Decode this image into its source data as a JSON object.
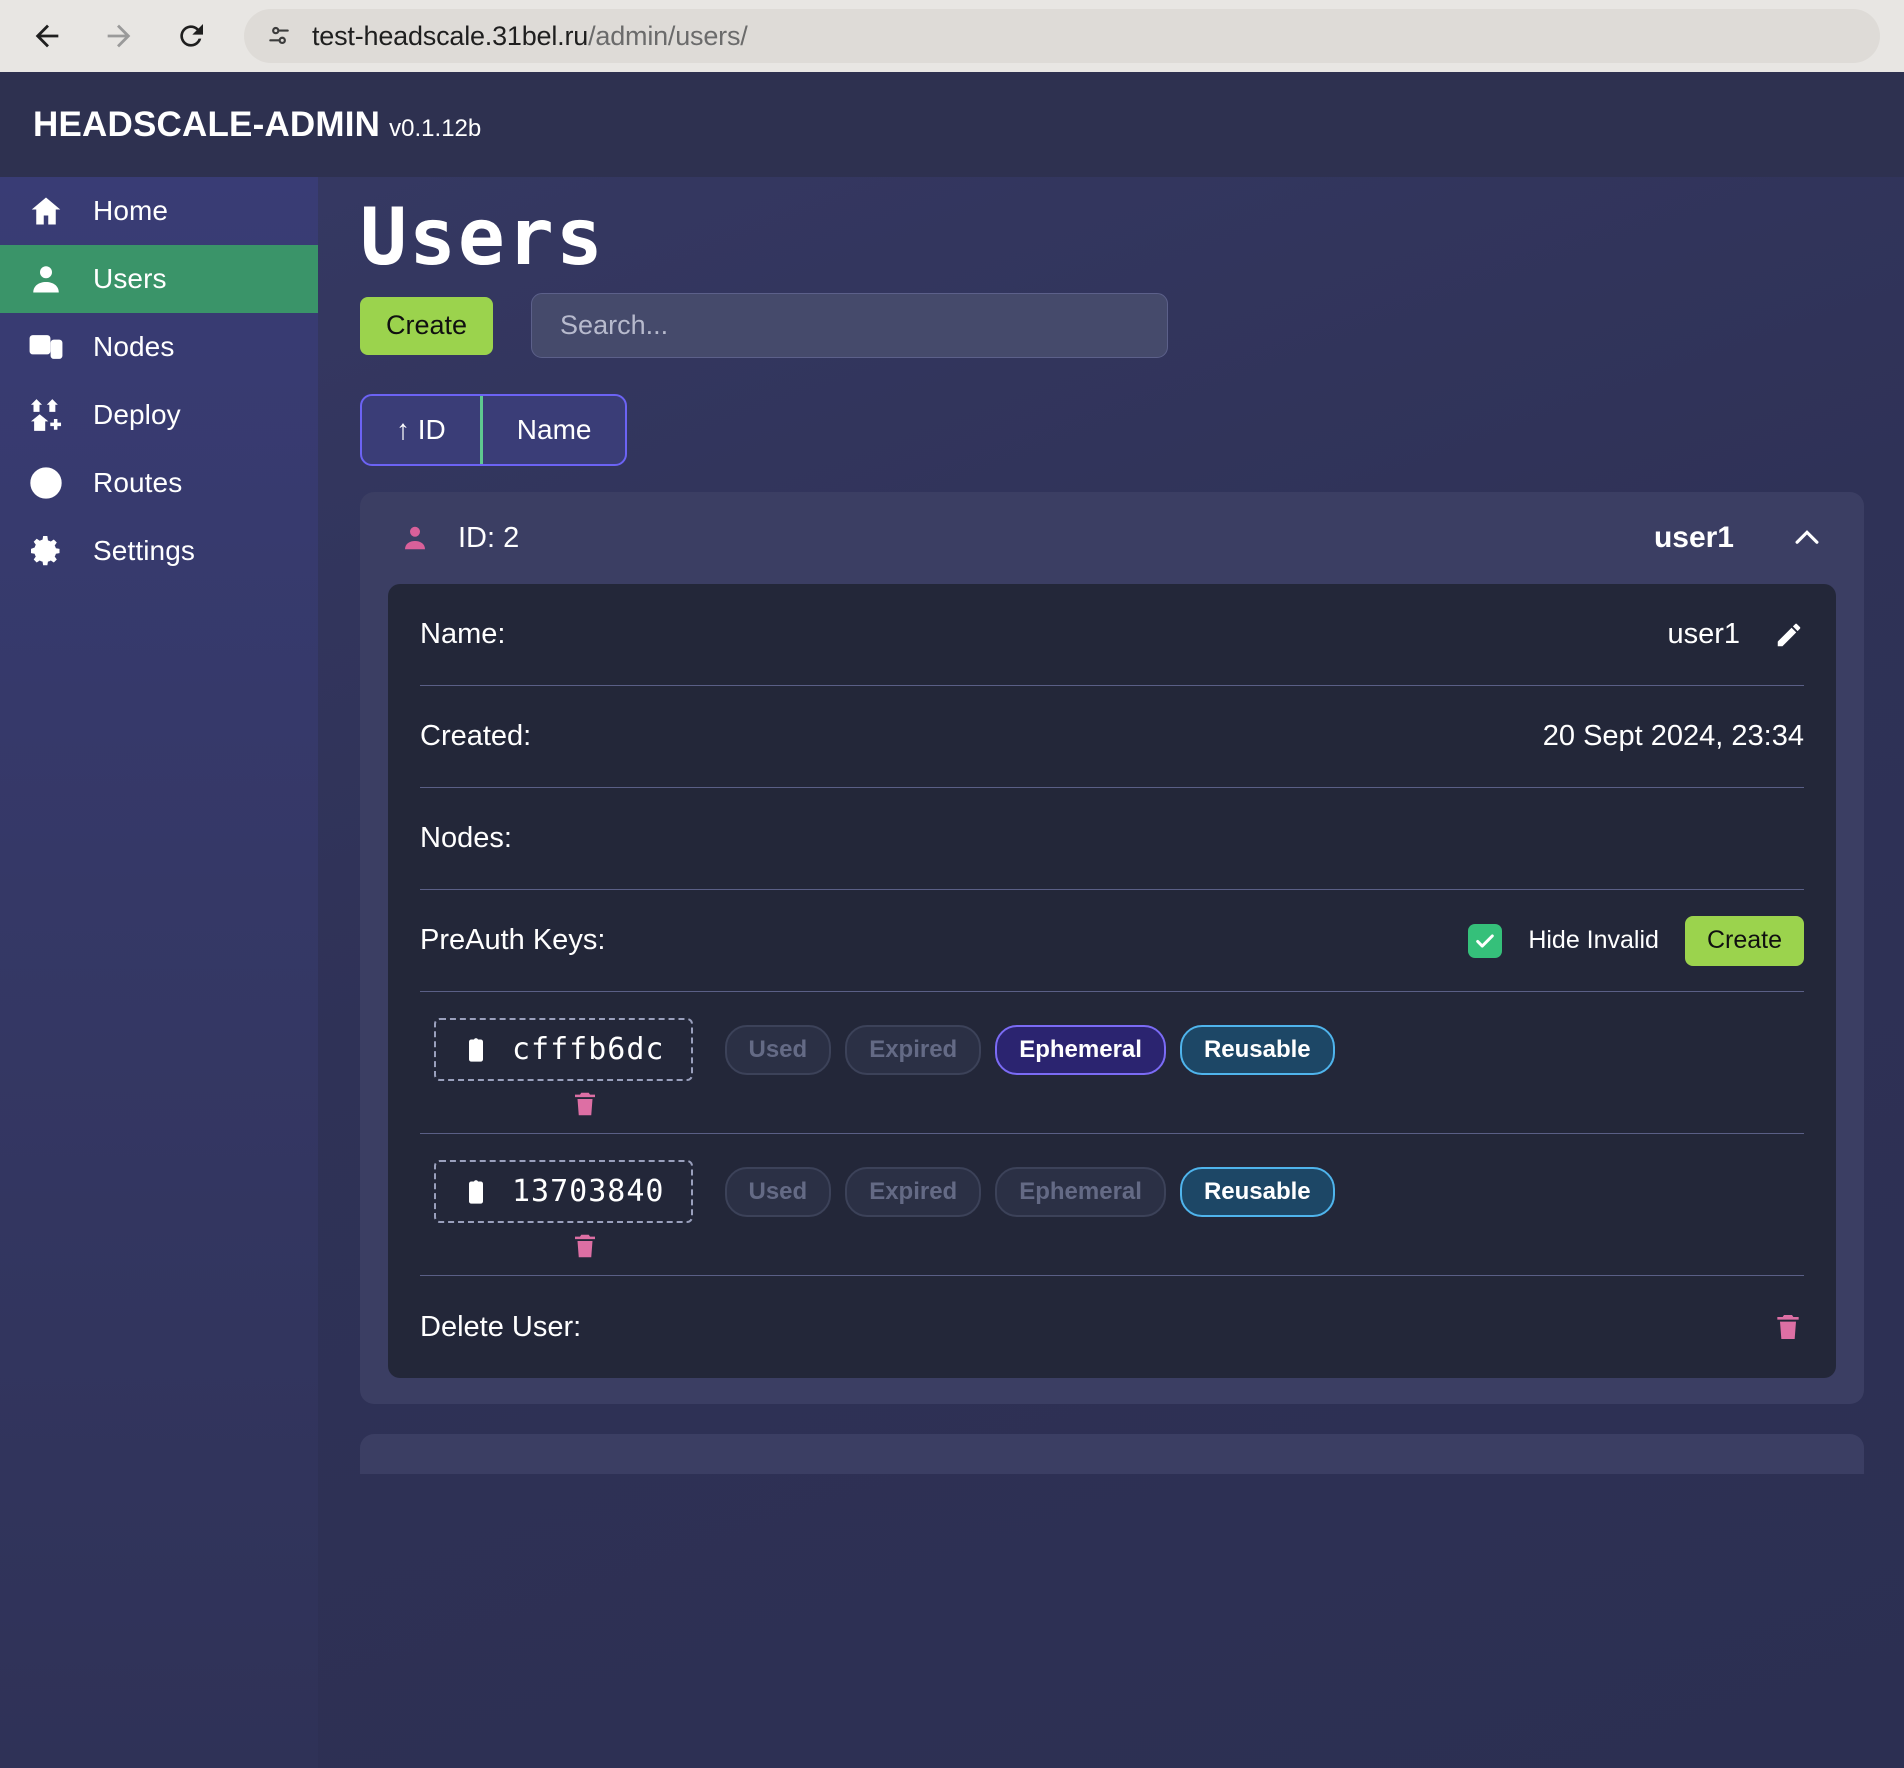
{
  "browser": {
    "back_icon": "arrow-left-icon",
    "forward_icon": "arrow-right-icon",
    "reload_icon": "reload-icon",
    "site_info_icon": "site-settings-icon",
    "url_host": "test-headscale.31bel.ru",
    "url_path": "/admin/users/"
  },
  "header": {
    "brand": "HEADSCALE-ADMIN",
    "version": "v0.1.12b"
  },
  "sidebar": {
    "items": [
      {
        "label": "Home",
        "icon": "home-icon",
        "active": false
      },
      {
        "label": "Users",
        "icon": "user-icon",
        "active": true
      },
      {
        "label": "Nodes",
        "icon": "devices-icon",
        "active": false
      },
      {
        "label": "Deploy",
        "icon": "deploy-icon",
        "active": false
      },
      {
        "label": "Routes",
        "icon": "routes-icon",
        "active": false
      },
      {
        "label": "Settings",
        "icon": "gear-icon",
        "active": false
      }
    ]
  },
  "main": {
    "title": "Users",
    "create_button": "Create",
    "search_placeholder": "Search...",
    "search_value": "",
    "sort": {
      "id_label": "↑ ID",
      "name_label": "Name"
    }
  },
  "user_card": {
    "id_label": "ID: 2",
    "name_header": "user1",
    "collapse_icon": "chevron-up-icon",
    "rows": {
      "name_label": "Name:",
      "name_value": "user1",
      "edit_icon": "pencil-icon",
      "created_label": "Created:",
      "created_value": "20 Sept 2024, 23:34",
      "nodes_label": "Nodes:",
      "nodes_value": "",
      "preauth_label": "PreAuth Keys:",
      "hide_invalid_label": "Hide Invalid",
      "hide_invalid_checked": true,
      "preauth_create": "Create",
      "delete_label": "Delete User:",
      "delete_icon": "trash-icon"
    },
    "keys": [
      {
        "key": "cfffb6dc",
        "copy_icon": "clipboard-icon",
        "badges": [
          {
            "label": "Used",
            "state": "off"
          },
          {
            "label": "Expired",
            "state": "off"
          },
          {
            "label": "Ephemeral",
            "state": "ephemeral"
          },
          {
            "label": "Reusable",
            "state": "reusable"
          }
        ],
        "delete_icon": "trash-icon"
      },
      {
        "key": "13703840",
        "copy_icon": "clipboard-icon",
        "badges": [
          {
            "label": "Used",
            "state": "off"
          },
          {
            "label": "Expired",
            "state": "off"
          },
          {
            "label": "Ephemeral",
            "state": "off"
          },
          {
            "label": "Reusable",
            "state": "reusable"
          }
        ],
        "delete_icon": "trash-icon"
      }
    ]
  },
  "colors": {
    "accent_green": "#9bd34d",
    "active_nav": "#3a9469",
    "pink": "#dd6fa4",
    "purple_border": "#7b6bf5",
    "blue_border": "#4fb4ec"
  }
}
